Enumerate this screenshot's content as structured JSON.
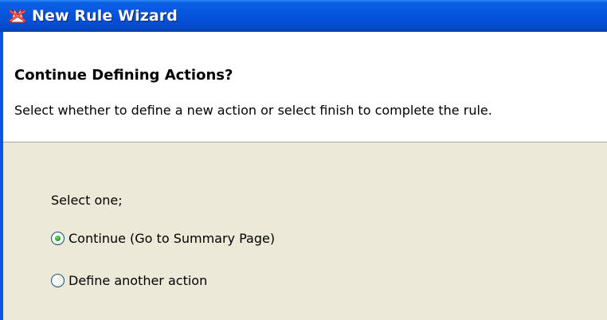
{
  "window": {
    "title": "New Rule Wizard",
    "icon": "rule-wizard-icon"
  },
  "header": {
    "title": "Continue Defining Actions?",
    "description": "Select whether to define a new action or select finish to complete the rule."
  },
  "content": {
    "prompt": "Select one;",
    "options": [
      {
        "label": "Continue (Go to Summary Page)",
        "selected": true
      },
      {
        "label": "Define another action",
        "selected": false
      }
    ]
  }
}
